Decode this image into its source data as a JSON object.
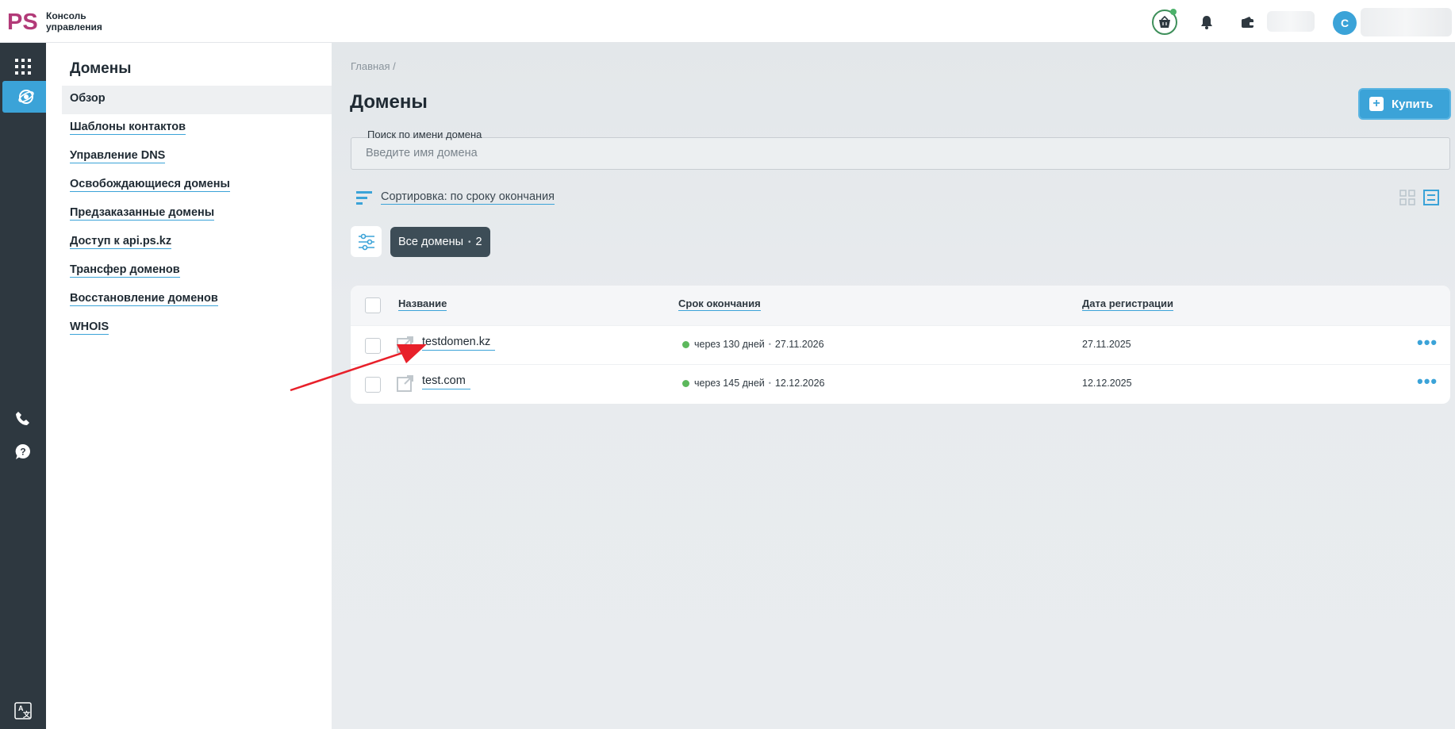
{
  "app": {
    "brand_line1": "Консоль",
    "brand_line2": "управления",
    "logo_text": "PS",
    "user_initial": "С"
  },
  "colors": {
    "accent": "#3ba3d8",
    "rail": "#2e3840",
    "brand": "#b23a78",
    "status_ok": "#5cb85c",
    "chip_bg": "#3d4d57"
  },
  "icons": {
    "topbar": [
      "basket-icon",
      "bell-icon",
      "wallet-icon"
    ],
    "rail": [
      "apps-grid-icon",
      "globe-icon",
      "phone-icon",
      "help-icon",
      "translate-icon"
    ]
  },
  "sidebar": {
    "title": "Домены",
    "items": [
      {
        "label": "Обзор",
        "active": true
      },
      {
        "label": "Шаблоны контактов"
      },
      {
        "label": "Управление DNS"
      },
      {
        "label": "Освобождающиеся домены"
      },
      {
        "label": "Предзаказанные домены"
      },
      {
        "label": "Доступ к api.ps.kz"
      },
      {
        "label": "Трансфер доменов"
      },
      {
        "label": "Восстановление доменов"
      },
      {
        "label": "WHOIS"
      }
    ]
  },
  "main": {
    "breadcrumb": "Главная  /",
    "title": "Домены",
    "buy_label": "Купить",
    "search": {
      "label": "Поиск по имени домена",
      "placeholder": "Введите имя домена",
      "value": ""
    },
    "sort_label": "Сортировка: по сроку окончания",
    "filter_chip": {
      "label": "Все домены",
      "count": "2"
    }
  },
  "table": {
    "columns": [
      "Название",
      "Срок окончания",
      "Дата регистрации"
    ],
    "rows": [
      {
        "name": "testdomen.kz",
        "expires_in": "через 130 дней",
        "expires_date": "27.11.2026",
        "registered": "27.11.2025"
      },
      {
        "name": "test.com",
        "expires_in": "через 145 дней",
        "expires_date": "12.12.2026",
        "registered": "12.12.2025"
      }
    ]
  }
}
